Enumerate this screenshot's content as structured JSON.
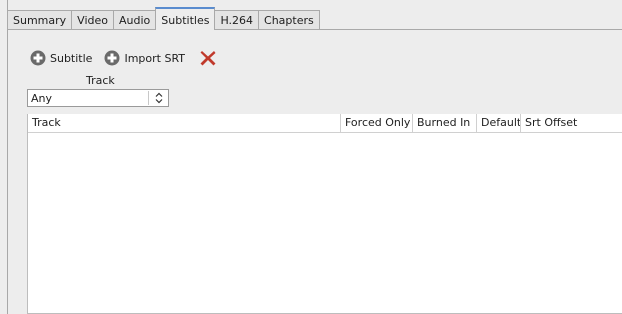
{
  "tabs": [
    {
      "label": "Summary",
      "active": false
    },
    {
      "label": "Video",
      "active": false
    },
    {
      "label": "Audio",
      "active": false
    },
    {
      "label": "Subtitles",
      "active": true
    },
    {
      "label": "H.264",
      "active": false
    },
    {
      "label": "Chapters",
      "active": false
    }
  ],
  "toolbar": {
    "add_subtitle_label": "Subtitle",
    "import_srt_label": "Import SRT",
    "add_icon": "plus-circle-icon",
    "remove_icon": "red-x-icon"
  },
  "track_filter": {
    "label": "Track",
    "selected": "Any"
  },
  "table": {
    "columns": [
      "Track",
      "Forced Only",
      "Burned In",
      "Default",
      "Srt Offset"
    ],
    "rows": []
  },
  "colors": {
    "active_tab_accent": "#5a8ccf",
    "remove_icon": "#c0392b",
    "add_icon": "#6a6a6a"
  }
}
